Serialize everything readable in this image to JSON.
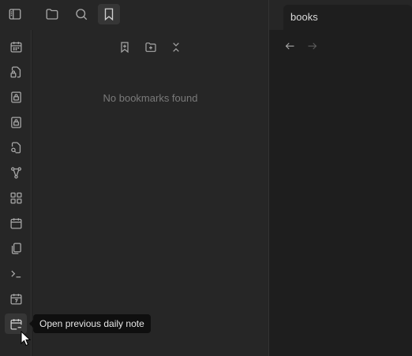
{
  "colors": {
    "icon": "#a8a8a8",
    "icon_dim": "#5c5c5c",
    "accent_bg": "#363636"
  },
  "topbar": {
    "buttons": [
      {
        "icon": "sidebar-toggle-icon"
      },
      {
        "icon": "folder-icon"
      },
      {
        "icon": "search-icon"
      },
      {
        "icon": "bookmark-icon",
        "active": true
      }
    ]
  },
  "ribbon": {
    "items": [
      {
        "icon": "calendar-icon"
      },
      {
        "icon": "file-lock-icon"
      },
      {
        "icon": "lock-icon"
      },
      {
        "icon": "lock-icon"
      },
      {
        "icon": "file-search-icon"
      },
      {
        "icon": "graph-icon"
      },
      {
        "icon": "layout-grid-icon"
      },
      {
        "icon": "calendar-icon"
      },
      {
        "icon": "copy-icon"
      },
      {
        "icon": "terminal-icon"
      },
      {
        "icon": "calendar-7-icon"
      },
      {
        "icon": "calendar-minus-icon",
        "hovered": true
      }
    ]
  },
  "bookmarks": {
    "toolbar": [
      {
        "icon": "bookmark-plus-icon"
      },
      {
        "icon": "folder-plus-icon"
      },
      {
        "icon": "collapse-all-icon"
      }
    ],
    "empty_message": "No bookmarks found"
  },
  "tabs": [
    {
      "title": "books"
    }
  ],
  "tooltip": {
    "text": "Open previous daily note"
  }
}
